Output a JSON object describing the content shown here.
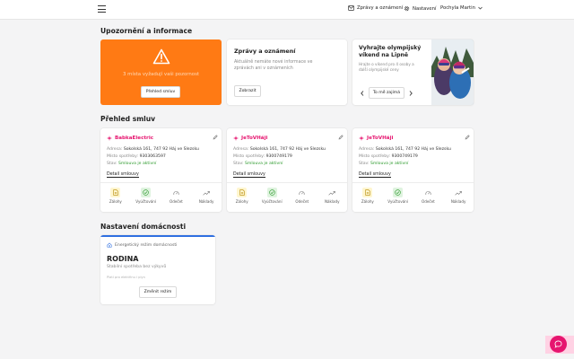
{
  "nav": {
    "menu_icon": "hamburger-icon",
    "messages_label": "Zprávy a oznámení",
    "settings_label": "Nastavení",
    "user_name": "Pochyla Martin"
  },
  "alerts_section": {
    "title": "Upozornění a informace",
    "warning_card": {
      "text": "3 místa vyžadují vaši pozornost",
      "button": "Přehled smluv",
      "icon": "warning-triangle-icon"
    },
    "messages_card": {
      "title": "Zprávy a oznámení",
      "text_line1": "Aktuálně nemáte nové informace ve",
      "text_line2": "zprávách ani v oznámeních",
      "button": "Zobrazit"
    },
    "promo_card": {
      "title_line1": "Vyhrajte olympijský",
      "title_line2": "víkend na Lipně",
      "text_line1": "Hrajte o víkend pro 4 osoby a",
      "text_line2": "další olympijské ceny",
      "button": "To mě zajímá"
    }
  },
  "contracts_section": {
    "title": "Přehled smluv",
    "contracts": [
      {
        "name": "BabkaElectric",
        "address_label": "Adresa:",
        "address": "Sokolská 161, 747 92 Háj ve Slezsku",
        "place_label": "Místo spotřeby:",
        "place": "9303063597",
        "status_label": "Stav:",
        "status": "Smlouva je aktivní",
        "detail": "Detail smlouvy"
      },
      {
        "name": "JeToVHáji",
        "address_label": "Adresa:",
        "address": "Sokolská 161, 747 92 Háj ve Slezsku",
        "place_label": "Místo spotřeby:",
        "place": "9300749179",
        "status_label": "Stav:",
        "status": "Smlouva je aktivní",
        "detail": "Detail smlouvy"
      },
      {
        "name": "JeToVHáji",
        "address_label": "Adresa:",
        "address": "Sokolská 161, 747 92 Háj ve Slezsku",
        "place_label": "Místo spotřeby:",
        "place": "9300749179",
        "status_label": "Stav:",
        "status": "Smlouva je aktivní",
        "detail": "Detail smlouvy"
      }
    ],
    "actions": [
      "Zálohy",
      "Vyúčtování",
      "Odečet",
      "Náklady"
    ]
  },
  "household_section": {
    "title": "Nastavení domácnosti",
    "mode_label": "Energetický režim domácnosti",
    "mode_name": "RODINA",
    "mode_desc": "Stabilní spotřeba bez výkyvů",
    "note": "Platí pro elektřinu i plyn",
    "button": "Změnit režim"
  },
  "colors": {
    "accent_orange": "#ff7a14",
    "brand_pink": "#e6156f",
    "status_green": "#2c9a2c",
    "household_blue": "#2f6fe0"
  }
}
